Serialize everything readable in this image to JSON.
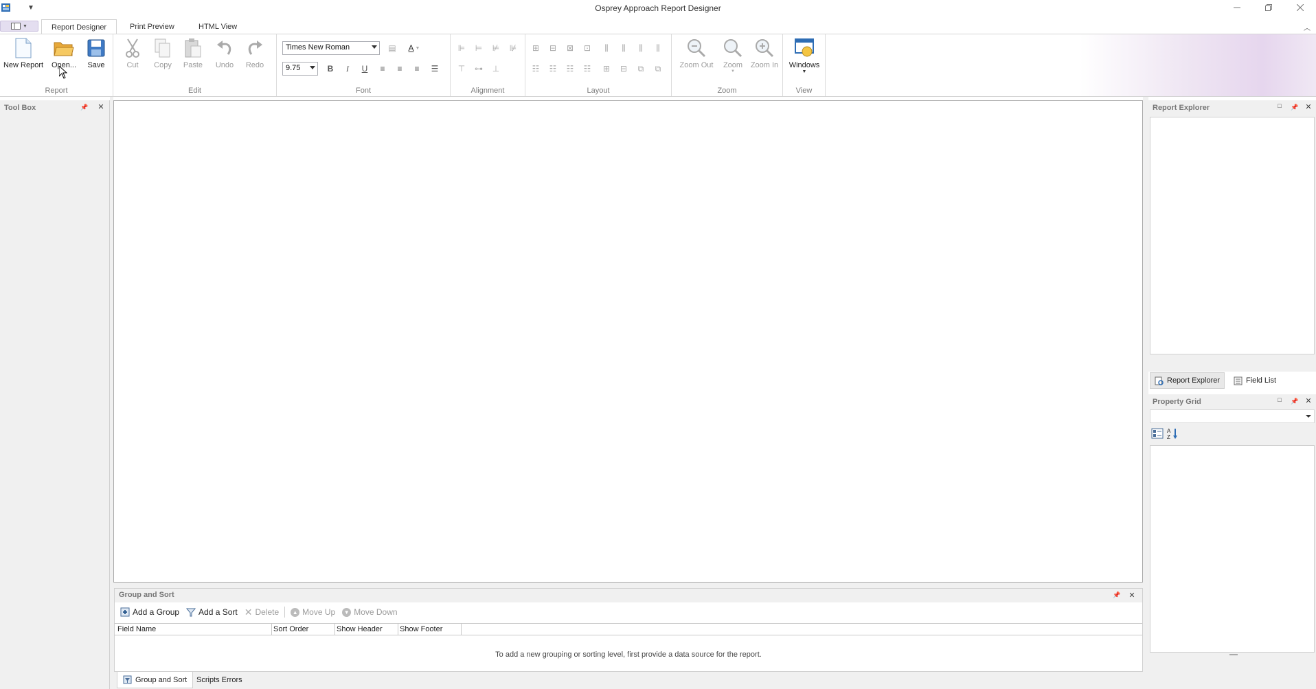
{
  "window": {
    "title": "Osprey Approach Report Designer",
    "minimize_icon": "minimize-icon",
    "restore_icon": "restore-icon",
    "close_icon": "close-icon"
  },
  "tabs": [
    {
      "label": "Report Designer",
      "active": true
    },
    {
      "label": "Print Preview",
      "active": false
    },
    {
      "label": "HTML View",
      "active": false
    }
  ],
  "ribbon": {
    "report": {
      "label": "Report",
      "new_report": "New Report",
      "open": "Open...",
      "save": "Save"
    },
    "edit": {
      "label": "Edit",
      "cut": "Cut",
      "copy": "Copy",
      "paste": "Paste",
      "undo": "Undo",
      "redo": "Redo"
    },
    "font": {
      "label": "Font",
      "font_family": "Times New Roman",
      "font_size": "9.75",
      "bold": "B",
      "italic": "I",
      "underline": "U",
      "font_color": "A"
    },
    "alignment": {
      "label": "Alignment"
    },
    "layout": {
      "label": "Layout"
    },
    "zoom": {
      "label": "Zoom",
      "zoom_out": "Zoom Out",
      "zoom": "Zoom",
      "zoom_in": "Zoom In"
    },
    "view": {
      "label": "View",
      "windows": "Windows"
    }
  },
  "toolbox": {
    "title": "Tool Box"
  },
  "group_sort": {
    "title": "Group and Sort",
    "add_group": "Add a Group",
    "add_sort": "Add a Sort",
    "delete": "Delete",
    "move_up": "Move Up",
    "move_down": "Move Down",
    "columns": [
      "Field Name",
      "Sort Order",
      "Show Header",
      "Show Footer"
    ],
    "empty_message": "To add a new grouping or sorting level, first provide a data source for the report."
  },
  "bottom_tabs": [
    {
      "label": "Group and Sort",
      "active": true
    },
    {
      "label": "Scripts Errors",
      "active": false
    }
  ],
  "report_explorer": {
    "title": "Report Explorer",
    "tab_explorer": "Report Explorer",
    "tab_fieldlist": "Field List"
  },
  "property_grid": {
    "title": "Property Grid"
  },
  "colors": {
    "accent_purple": "#e6d6ee",
    "panel_bg": "#f0f0f0",
    "disabled_text": "#9a9a9a"
  }
}
